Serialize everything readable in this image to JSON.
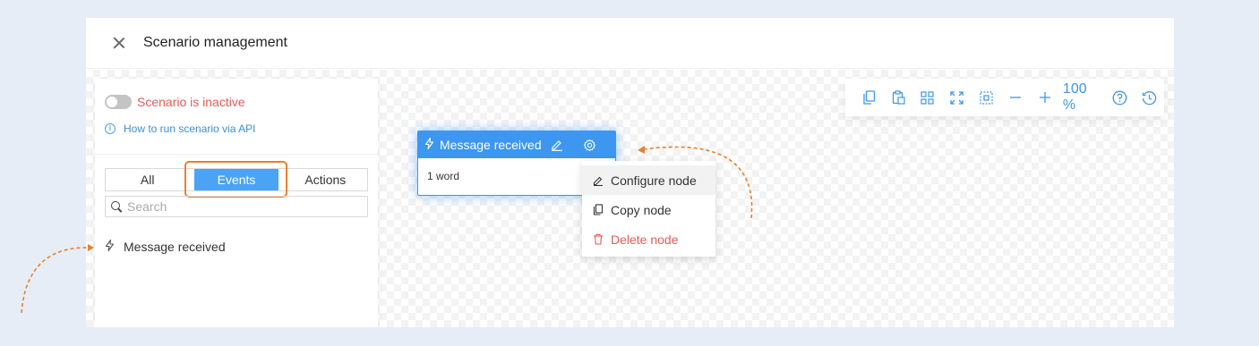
{
  "header": {
    "title": "Scenario management"
  },
  "sidebar": {
    "status": "Scenario is inactive",
    "api_link": "How to run scenario via API",
    "tabs": [
      {
        "label": "All"
      },
      {
        "label": "Events",
        "active": true
      },
      {
        "label": "Actions"
      }
    ],
    "search_placeholder": "Search",
    "events": [
      {
        "label": "Message received"
      }
    ]
  },
  "toolbar": {
    "zoom": "100 %",
    "icons": [
      "copy-icon",
      "paste-icon",
      "grid-icon",
      "fit-screen-icon",
      "frame-icon",
      "zoom-out-icon",
      "zoom-in-icon",
      "help-icon",
      "history-icon"
    ]
  },
  "node": {
    "title": "Message received",
    "body": "1 word"
  },
  "context_menu": {
    "items": [
      {
        "label": "Configure node"
      },
      {
        "label": "Copy node"
      },
      {
        "label": "Delete node",
        "danger": true
      }
    ]
  },
  "colors": {
    "accent": "#3d96f0",
    "danger": "#e55a5a",
    "annotation": "#e8812f",
    "background": "#e7edf6"
  }
}
